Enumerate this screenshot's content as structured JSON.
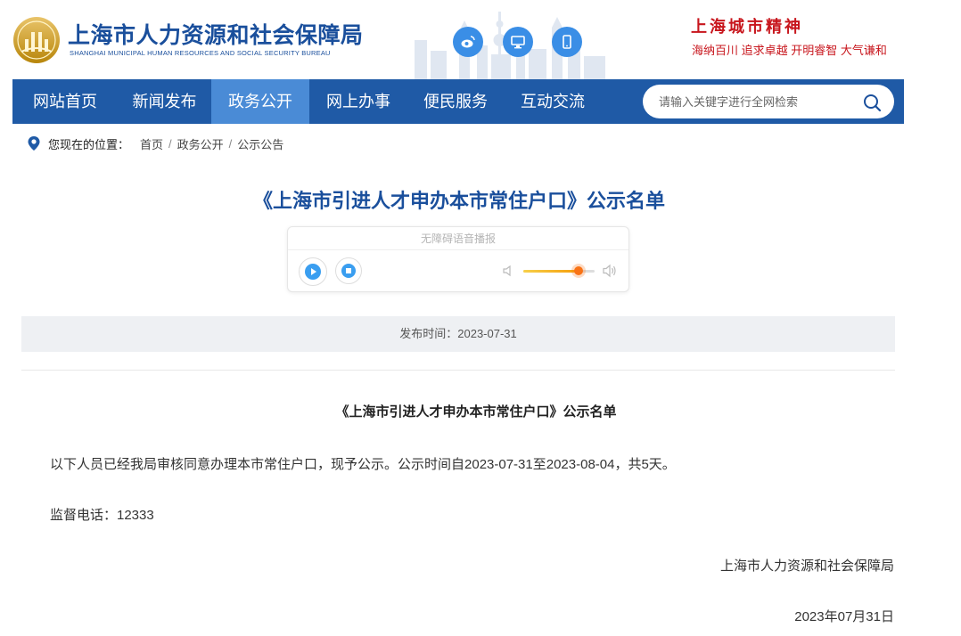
{
  "header": {
    "site_name": "上海市人力资源和社会保障局",
    "site_name_en": "SHANGHAI MUNICIPAL HUMAN RESOURCES AND SOCIAL SECURITY BUREAU",
    "icons": [
      "weibo-icon",
      "desktop-icon",
      "mobile-icon"
    ],
    "spirit_title": "上海城市精神",
    "spirit_sub": "海纳百川  追求卓越  开明睿智  大气谦和",
    "colors": {
      "brand": "#1a4f9c",
      "spirit": "#c8161d",
      "icon_bg": "#3a8ee6"
    }
  },
  "nav": {
    "items": [
      {
        "label": "网站首页",
        "active": false
      },
      {
        "label": "新闻发布",
        "active": false
      },
      {
        "label": "政务公开",
        "active": true
      },
      {
        "label": "网上办事",
        "active": false
      },
      {
        "label": "便民服务",
        "active": false
      },
      {
        "label": "互动交流",
        "active": false
      }
    ],
    "search_placeholder": "请输入关键字进行全网检索",
    "colors": {
      "bar": "#1f5aa6",
      "active": "#4a8bd6"
    }
  },
  "breadcrumb": {
    "label": "您现在的位置：",
    "items": [
      "首页",
      "政务公开",
      "公示公告"
    ],
    "separator": "/"
  },
  "page_title": "《上海市引进人才申办本市常住户口》公示名单",
  "player": {
    "label": "无障碍语音播报",
    "volume_fraction": 0.78
  },
  "publish": {
    "text": "发布时间：2023-07-31"
  },
  "article": {
    "title": "《上海市引进人才申办本市常住户口》公示名单",
    "paragraphs": [
      "以下人员已经我局审核同意办理本市常住户口，现予公示。公示时间自2023-07-31至2023-08-04，共5天。",
      "监督电话：12333"
    ],
    "signature": "上海市人力资源和社会保障局",
    "date": "2023年07月31日"
  }
}
